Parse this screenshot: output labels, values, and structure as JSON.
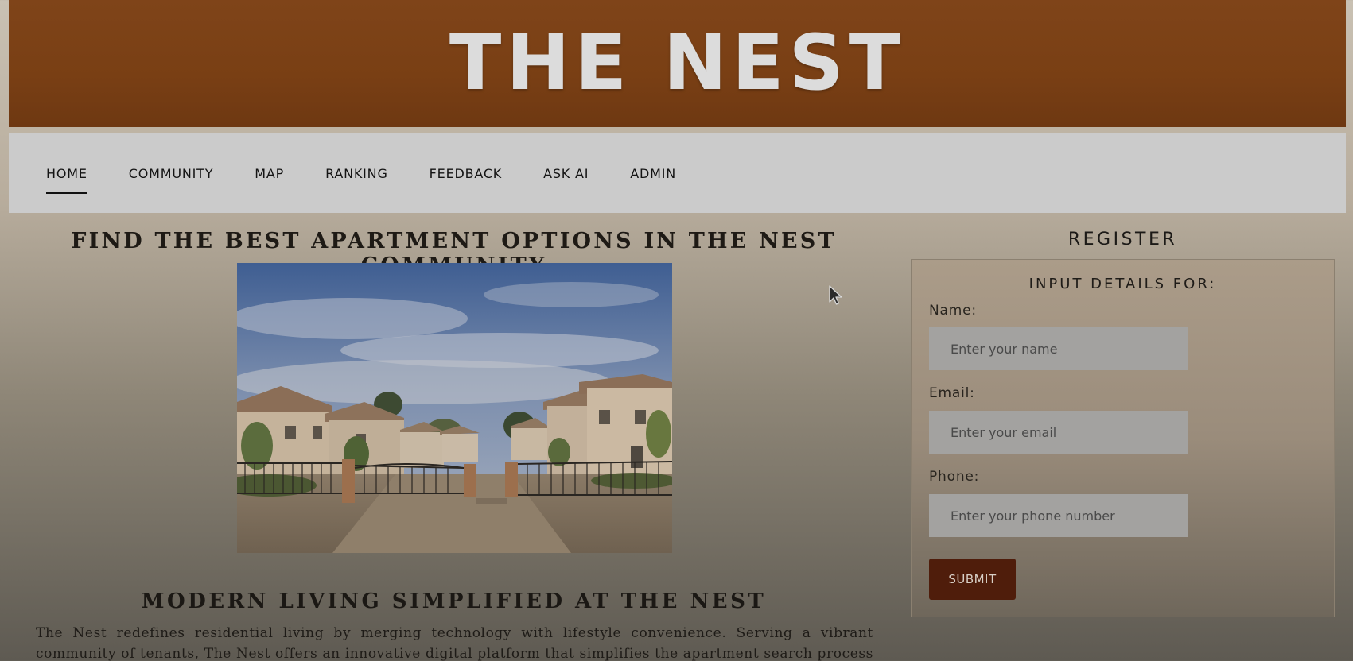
{
  "header": {
    "title": "THE NEST",
    "background": "#793f14"
  },
  "nav": {
    "items": [
      {
        "label": "HOME",
        "active": true
      },
      {
        "label": "COMMUNITY",
        "active": false
      },
      {
        "label": "MAP",
        "active": false
      },
      {
        "label": "RANKING",
        "active": false
      },
      {
        "label": "FEEDBACK",
        "active": false
      },
      {
        "label": "ASK AI",
        "active": false
      },
      {
        "label": "ADMIN",
        "active": false
      }
    ]
  },
  "main": {
    "heading": "FIND THE BEST APARTMENT OPTIONS IN THE NEST COMMUNITY",
    "image": {
      "name": "gated-community-photo"
    },
    "subheading": "MODERN LIVING SIMPLIFIED AT THE NEST",
    "body": "The Nest redefines residential living by merging technology with lifestyle convenience. Serving a vibrant community of tenants, The Nest offers an innovative digital platform that simplifies the apartment search process while fostering a"
  },
  "register": {
    "title": "REGISTER",
    "form_heading": "INPUT DETAILS FOR:",
    "fields": {
      "name": {
        "label": "Name:",
        "placeholder": "Enter your name",
        "value": ""
      },
      "email": {
        "label": "Email:",
        "placeholder": "Enter your email",
        "value": ""
      },
      "phone": {
        "label": "Phone:",
        "placeholder": "Enter your phone number",
        "value": ""
      }
    },
    "submit_label": "SUBMIT",
    "submit_color": "#4f1d0b"
  },
  "icons": {
    "cursor": "mouse-pointer-icon"
  }
}
